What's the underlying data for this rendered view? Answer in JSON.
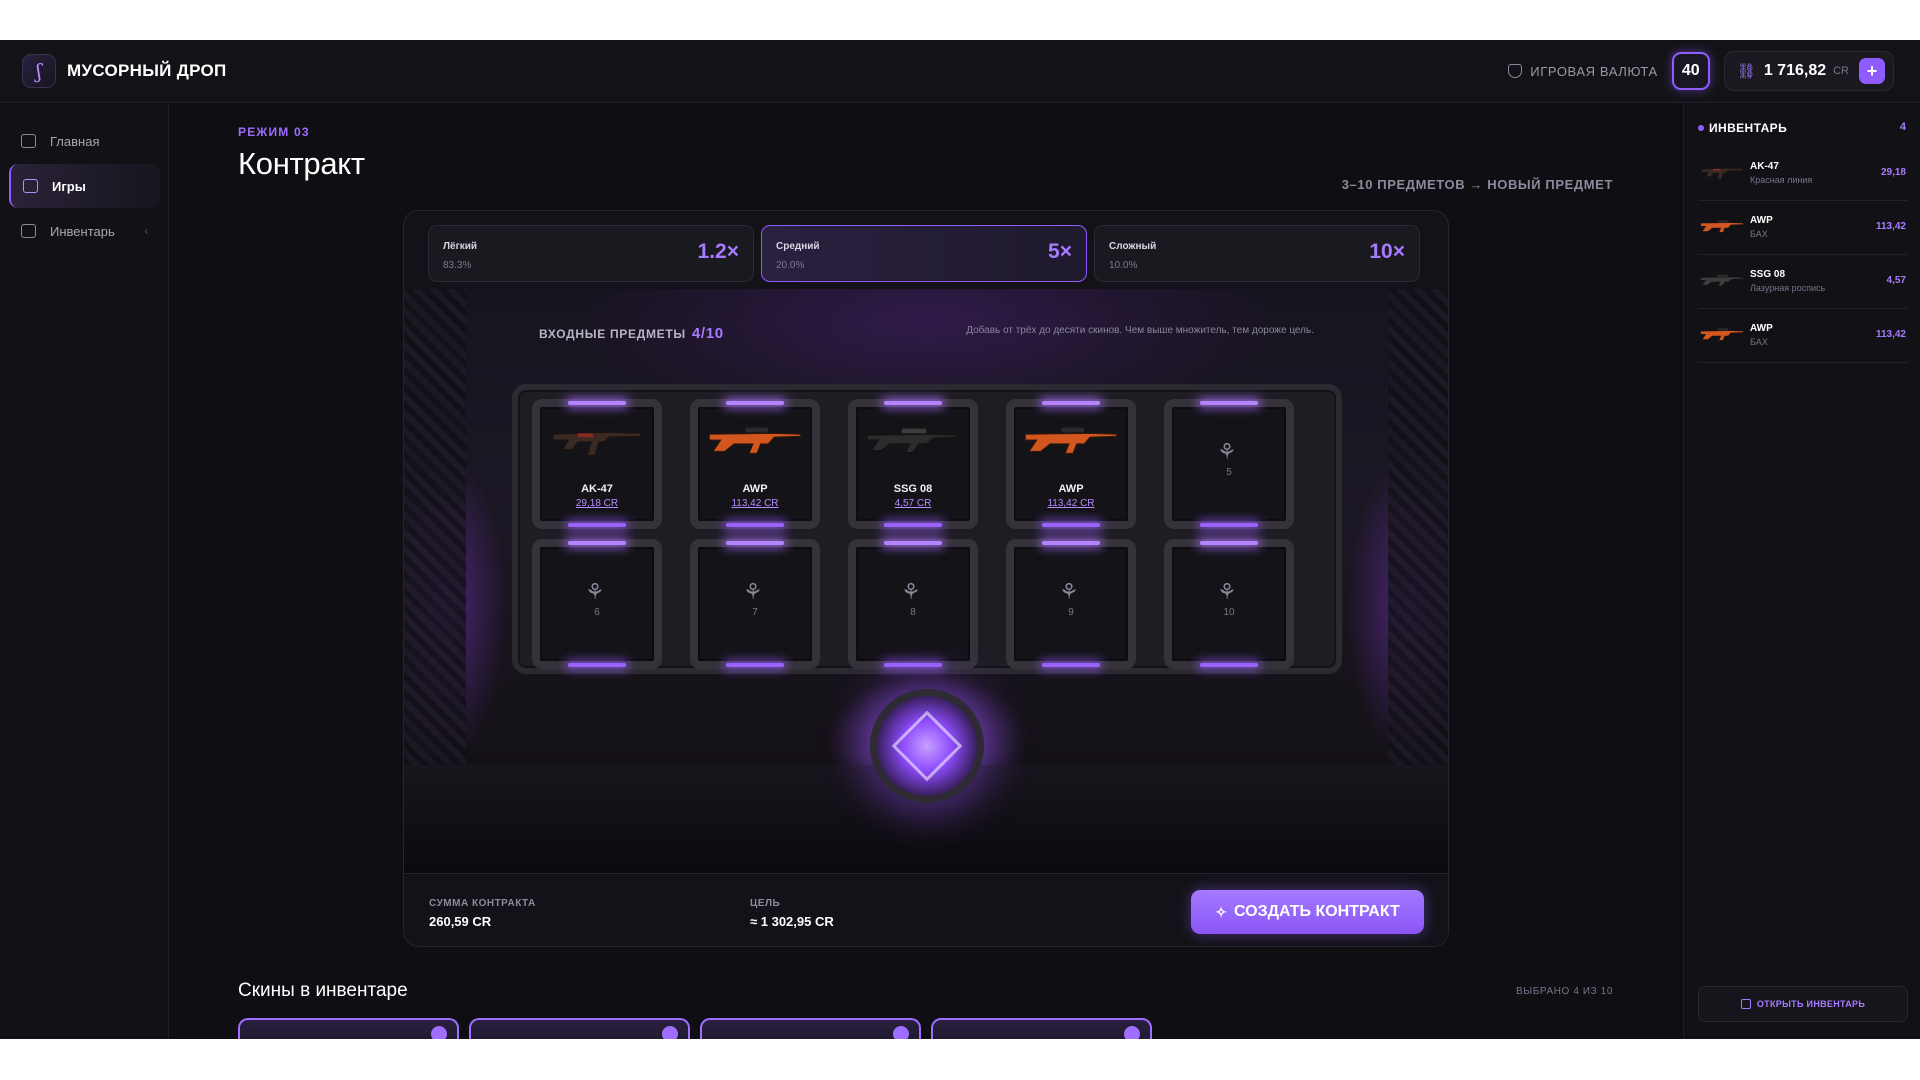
{
  "header": {
    "brand": "МУСОРНЫЙ ДРОП",
    "logo_icon": "phoenix-logo",
    "currency_label": "ИГРОВАЯ ВАЛЮТА",
    "level": "40",
    "balance": "1 716,82",
    "balance_unit": "CR",
    "add_label": "+"
  },
  "sidebar": {
    "items": [
      {
        "label": "Главная",
        "icon": "home-icon",
        "active": false
      },
      {
        "label": "Игры",
        "icon": "gamepad-icon",
        "active": true
      },
      {
        "label": "Инвентарь",
        "icon": "backpack-icon",
        "active": false,
        "chevron": "‹"
      }
    ]
  },
  "main": {
    "mode_tag": "РЕЖИМ 03",
    "title": "Контракт",
    "subtitle": "3–10 ПРЕДМЕТОВ → НОВЫЙ ПРЕДМЕТ",
    "difficulties": [
      {
        "name": "Лёгкий",
        "chance": "83.3%",
        "multiplier": "1.2×",
        "active": false
      },
      {
        "name": "Средний",
        "chance": "20.0%",
        "multiplier": "5×",
        "active": true
      },
      {
        "name": "Сложный",
        "chance": "10.0%",
        "multiplier": "10×",
        "active": false
      }
    ],
    "slots_header": "ВХОДНЫЕ ПРЕДМЕТЫ",
    "slots_count": "4/10",
    "slots_hint": "Добавь от трёх до десяти скинов. Чем выше множитель, тем дороже цель.",
    "slots": [
      {
        "name": "AK-47",
        "price": "29,18 CR",
        "gun": "ak"
      },
      {
        "name": "AWP",
        "price": "113,42 CR",
        "gun": "awp"
      },
      {
        "name": "SSG 08",
        "price": "4,57 CR",
        "gun": "ssg"
      },
      {
        "name": "AWP",
        "price": "113,42 CR",
        "gun": "awp"
      },
      {
        "number": "5"
      },
      {
        "number": "6"
      },
      {
        "number": "7"
      },
      {
        "number": "8"
      },
      {
        "number": "9"
      },
      {
        "number": "10"
      }
    ],
    "sum_label": "СУММА КОНТРАКТА",
    "sum_value": "260,59 CR",
    "goal_label": "ЦЕЛЬ",
    "goal_value": "≈ 1 302,95 CR",
    "create_button": "СОЗДАТЬ КОНТРАКТ",
    "inventory_title": "Скины в инвентаре",
    "selected_text": "ВЫБРАНО 4 ИЗ 10"
  },
  "inventory_panel": {
    "title": "ИНВЕНТАРЬ",
    "count": "4",
    "items": [
      {
        "name": "AK-47",
        "skin": "Красная линия",
        "value": "29,18",
        "gun": "ak"
      },
      {
        "name": "AWP",
        "skin": "БАХ",
        "value": "113,42",
        "gun": "awp"
      },
      {
        "name": "SSG 08",
        "skin": "Лазурная роспись",
        "value": "4,57",
        "gun": "ssg"
      },
      {
        "name": "AWP",
        "skin": "БАХ",
        "value": "113,42",
        "gun": "awp"
      }
    ],
    "open_button": "ОТКРЫТЬ ИНВЕНТАРЬ"
  },
  "colors": {
    "accent": "#8f5cff",
    "background": "#0f0f13",
    "panel": "#121216"
  }
}
